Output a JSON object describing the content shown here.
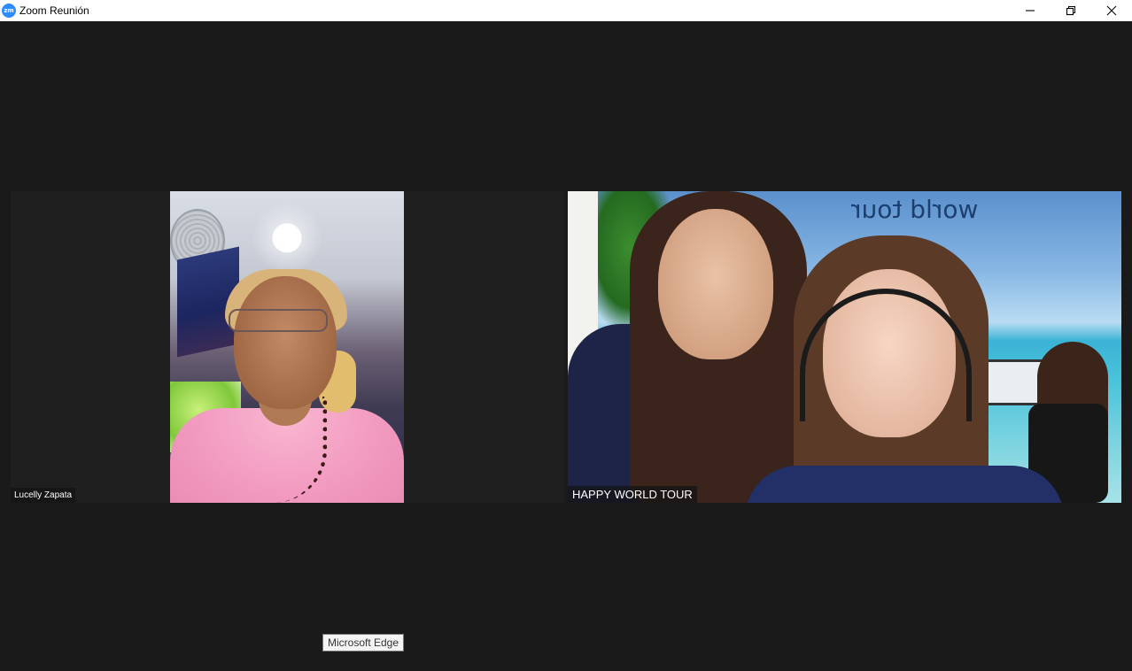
{
  "window": {
    "title": "Zoom Reunión",
    "app_icon_text": "zm",
    "icon_color": "#2d8cff",
    "controls": [
      "minimize-icon",
      "restore-icon",
      "close-icon"
    ]
  },
  "participants": [
    {
      "name": "Lucelly Zapata"
    },
    {
      "name": "HAPPY WORLD TOUR",
      "background_text": "world tour"
    }
  ],
  "tooltip": {
    "text": "Microsoft Edge"
  }
}
